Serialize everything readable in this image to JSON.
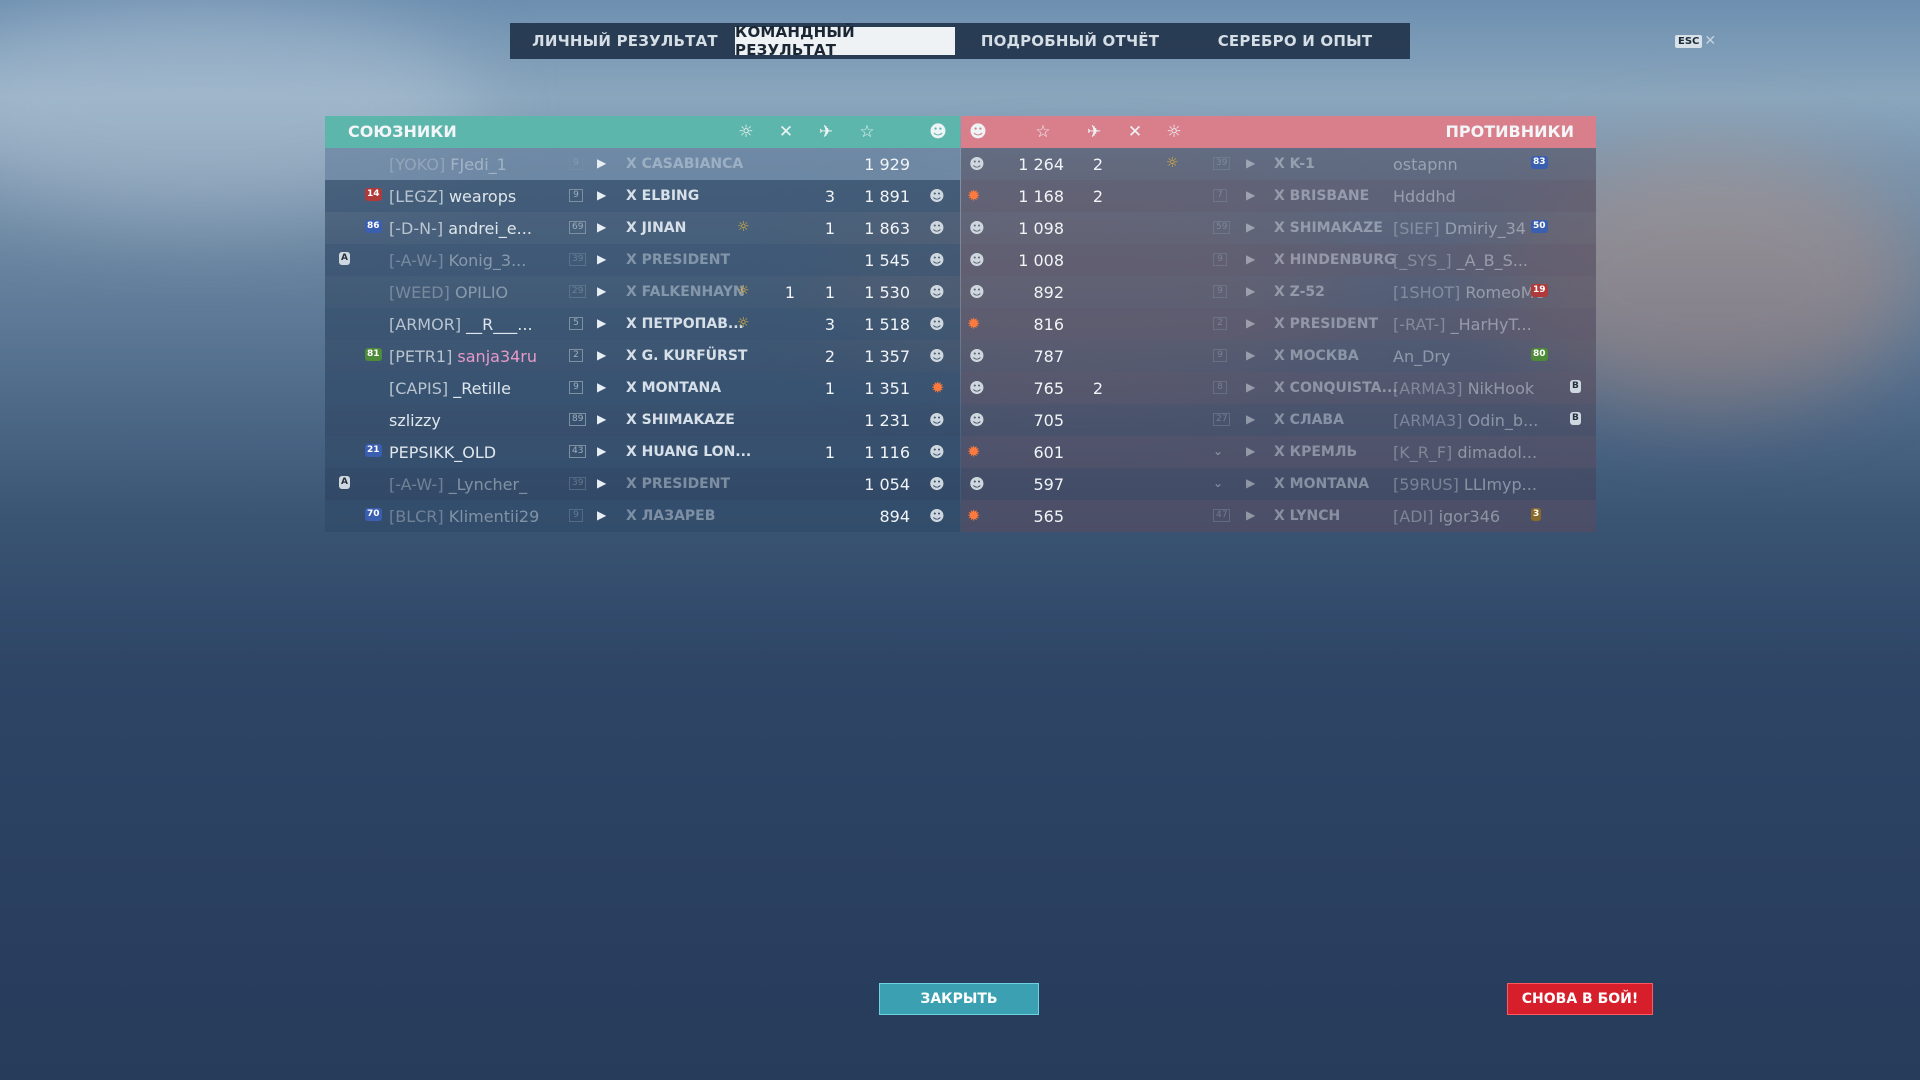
{
  "tabs": [
    {
      "label": "ЛИЧНЫЙ РЕЗУЛЬТАТ",
      "active": false
    },
    {
      "label": "КОМАНДНЫЙ РЕЗУЛЬТАТ",
      "active": true
    },
    {
      "label": "ПОДРОБНЫЙ ОТЧЁТ",
      "active": false
    },
    {
      "label": "СЕРЕБРО И ОПЫТ",
      "active": false
    }
  ],
  "esc_label": "ESC",
  "allies": {
    "title": "СОЮЗНИКИ",
    "rows": [
      {
        "clan": "[YOKO]",
        "name": "FJedi_1",
        "tier": "9",
        "ship": "X CASABIANCA",
        "score": "1 929",
        "kills": "",
        "planes": "",
        "dim": true
      },
      {
        "clan": "[LEGZ]",
        "name": "wearops",
        "tier": "9",
        "ship": "X ELBING",
        "score": "1 891",
        "kills": "3",
        "planes": ""
      },
      {
        "clan": "[-D-N-]",
        "name": "andrei_e...",
        "tier": "69",
        "ship": "X JINAN",
        "score": "1 863",
        "kills": "1",
        "planes": ""
      },
      {
        "clan": "[-A-W-]",
        "name": "Konig_3...",
        "tier": "39",
        "ship": "X PRESIDENT",
        "score": "1 545",
        "kills": "",
        "planes": "",
        "dim": true
      },
      {
        "clan": "[WEED]",
        "name": "OPILIO",
        "tier": "29",
        "ship": "X FALKENHAYN",
        "score": "1 530",
        "kills": "1",
        "planes": "1",
        "dim": true
      },
      {
        "clan": "[ARMOR]",
        "name": "__R___...",
        "tier": "5",
        "ship": "X ПЕТРОПАВ...",
        "score": "1 518",
        "kills": "3",
        "planes": ""
      },
      {
        "clan": "[PETR1]",
        "name": "sanja34ru",
        "tier": "2",
        "ship": "X G. KURFÜRST",
        "score": "1 357",
        "kills": "2",
        "planes": ""
      },
      {
        "clan": "[CAPIS]",
        "name": "_Retille",
        "tier": "9",
        "ship": "X MONTANA",
        "score": "1 351",
        "kills": "1",
        "planes": ""
      },
      {
        "clan": "",
        "name": "szlizzy",
        "tier": "89",
        "ship": "X SHIMAKAZE",
        "score": "1 231",
        "kills": "",
        "planes": ""
      },
      {
        "clan": "",
        "name": "PEPSIKK_OLD",
        "tier": "43",
        "ship": "X HUANG LON...",
        "score": "1 116",
        "kills": "1",
        "planes": ""
      },
      {
        "clan": "[-A-W-]",
        "name": "_Lyncher_",
        "tier": "39",
        "ship": "X PRESIDENT",
        "score": "1 054",
        "kills": "",
        "planes": "",
        "dim": true
      },
      {
        "clan": "[BLCR]",
        "name": "Klimentii29",
        "tier": "9",
        "ship": "X ЛАЗАРЕВ",
        "score": "894",
        "kills": "",
        "planes": "",
        "dim": true
      }
    ],
    "badges": [
      {
        "row": 1,
        "text": "14",
        "color": "#b03a3a"
      },
      {
        "row": 2,
        "text": "86",
        "color": "#3b5fb0"
      },
      {
        "row": 6,
        "text": "81",
        "color": "#4d8a3a"
      },
      {
        "row": 9,
        "text": "21",
        "color": "#3b5fb0"
      },
      {
        "row": 11,
        "text": "70",
        "color": "#3b5fb0"
      }
    ],
    "flag_rows": [
      3,
      10
    ],
    "flag_label": "A"
  },
  "enemies": {
    "title": "ПРОТИВНИКИ",
    "rows": [
      {
        "score": "1 264",
        "kills": "2",
        "tier": "39",
        "ship": "X K-1",
        "clan": "",
        "name": "ostapnn",
        "dim": true
      },
      {
        "score": "1 168",
        "kills": "2",
        "tier": "7",
        "ship": "X BRISBANE",
        "clan": "",
        "name": "Hdddhd",
        "dim": true
      },
      {
        "score": "1 098",
        "kills": "",
        "tier": "59",
        "ship": "X SHIMAKAZE",
        "clan": "[SIEF]",
        "name": "Dmiriy_34",
        "dim": true
      },
      {
        "score": "1 008",
        "kills": "",
        "tier": "9",
        "ship": "X HINDENBURG",
        "clan": "[_SYS_]",
        "name": "_A_B_S...",
        "dim": true
      },
      {
        "score": "892",
        "kills": "",
        "tier": "9",
        "ship": "X Z-52",
        "clan": "[1SHOT]",
        "name": "RomeoMe",
        "dim": true
      },
      {
        "score": "816",
        "kills": "",
        "tier": "2",
        "ship": "X PRESIDENT",
        "clan": "[-RAT-]",
        "name": "_HarHyT...",
        "dim": true
      },
      {
        "score": "787",
        "kills": "",
        "tier": "9",
        "ship": "X МОСКВА",
        "clan": "",
        "name": "An_Dry",
        "dim": true
      },
      {
        "score": "765",
        "kills": "2",
        "tier": "8",
        "ship": "X CONQUISTA...",
        "clan": "[ARMA3]",
        "name": "NikHook",
        "dim": true
      },
      {
        "score": "705",
        "kills": "",
        "tier": "27",
        "ship": "X СЛАВА",
        "clan": "[ARMA3]",
        "name": "Odin_b...",
        "dim": true
      },
      {
        "score": "601",
        "kills": "",
        "tier": "",
        "ship": "X КРЕМЛЬ",
        "clan": "[K_R_F]",
        "name": "dimadol...",
        "dim": true
      },
      {
        "score": "597",
        "kills": "",
        "tier": "",
        "ship": "X MONTANA",
        "clan": "[59RUS]",
        "name": "LLImyp...",
        "dim": true
      },
      {
        "score": "565",
        "kills": "",
        "tier": "47",
        "ship": "X LYNCH",
        "clan": "[ADI]",
        "name": "igor346",
        "dim": true
      }
    ],
    "badges": [
      {
        "row": 0,
        "text": "83",
        "color": "#3b5fb0"
      },
      {
        "row": 2,
        "text": "50",
        "color": "#3b5fb0"
      },
      {
        "row": 4,
        "text": "19",
        "color": "#b03a3a"
      },
      {
        "row": 6,
        "text": "80",
        "color": "#4d8a3a"
      },
      {
        "row": 11,
        "text": "3",
        "color": "#8a6a2a"
      }
    ],
    "flag_rows": [
      7,
      8
    ],
    "flag_label": "B"
  },
  "buttons": {
    "close": "ЗАКРЫТЬ",
    "battle": "СНОВА В БОЙ!"
  },
  "colors": {
    "allies_header": "#5db6ab",
    "enemies_header": "#d97f8c",
    "battle_button": "#d71f2b",
    "close_button": "#3aa0b2"
  }
}
